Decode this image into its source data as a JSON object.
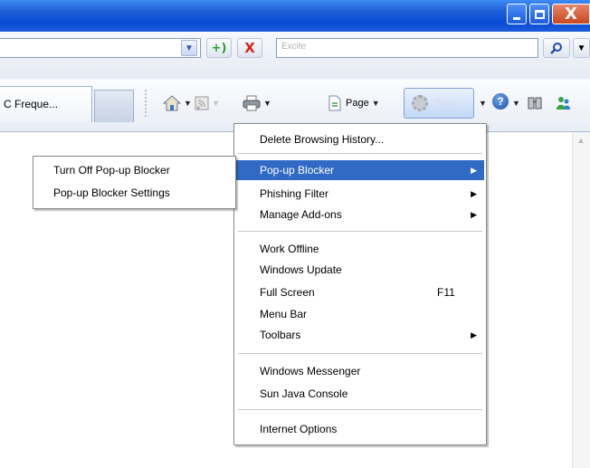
{
  "window": {
    "close_glyph": "X"
  },
  "address_bar": {
    "value": "",
    "go_glyph": "+)",
    "stop_glyph": "X",
    "search_placeholder": "Excite"
  },
  "tabs": [
    {
      "label": "C Freque..."
    }
  ],
  "command_bar": {
    "page_label": "Page",
    "tools_label": "Tools",
    "help_glyph": "?"
  },
  "tools_menu": {
    "items": [
      {
        "label": "Delete Browsing History...",
        "submenu": false,
        "shortcut": ""
      },
      {
        "label": "Pop-up Blocker",
        "submenu": true,
        "shortcut": "",
        "selected": true
      },
      {
        "label": "Phishing Filter",
        "submenu": true,
        "shortcut": ""
      },
      {
        "label": "Manage Add-ons",
        "submenu": true,
        "shortcut": ""
      },
      {
        "label": "Work Offline",
        "submenu": false,
        "shortcut": ""
      },
      {
        "label": "Windows Update",
        "submenu": false,
        "shortcut": ""
      },
      {
        "label": "Full Screen",
        "submenu": false,
        "shortcut": "F11"
      },
      {
        "label": "Menu Bar",
        "submenu": false,
        "shortcut": ""
      },
      {
        "label": "Toolbars",
        "submenu": true,
        "shortcut": ""
      },
      {
        "label": "Windows Messenger",
        "submenu": false,
        "shortcut": ""
      },
      {
        "label": "Sun Java Console",
        "submenu": false,
        "shortcut": ""
      },
      {
        "label": "Internet Options",
        "submenu": false,
        "shortcut": ""
      }
    ]
  },
  "popup_blocker_submenu": {
    "items": [
      {
        "label": "Turn Off Pop-up Blocker"
      },
      {
        "label": "Pop-up Blocker Settings"
      }
    ]
  },
  "colors": {
    "titlebar": "#0a4bd6",
    "menu_highlight": "#316ac5",
    "close_button": "#c9461e"
  },
  "icons": [
    "minimize-icon",
    "maximize-icon",
    "close-icon",
    "dropdown-arrow-icon",
    "go-icon",
    "stop-icon",
    "search-icon",
    "home-icon",
    "feeds-icon",
    "print-icon",
    "page-icon",
    "gear-icon",
    "help-icon",
    "research-icon",
    "messenger-icon",
    "submenu-arrow-icon"
  ]
}
